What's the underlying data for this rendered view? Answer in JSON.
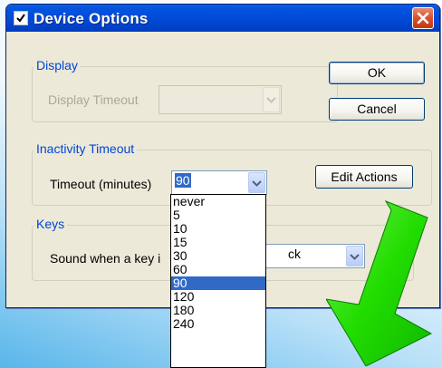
{
  "window": {
    "title": "Device Options",
    "title_icon": "checkbox-icon",
    "close_icon": "close-icon"
  },
  "display_group": {
    "legend": "Display",
    "timeout_label": "Display Timeout",
    "timeout_value": ""
  },
  "buttons": {
    "ok": "OK",
    "cancel": "Cancel",
    "edit_actions": "Edit Actions"
  },
  "inactivity_group": {
    "legend": "Inactivity Timeout",
    "timeout_label": "Timeout (minutes)",
    "timeout_value": "90",
    "options": [
      "never",
      "5",
      "10",
      "15",
      "30",
      "60",
      "90",
      "120",
      "180",
      "240"
    ],
    "selected_option": "90"
  },
  "keys_group": {
    "legend": "Keys",
    "sound_label": "Sound when a key i",
    "sound_value_visible": "ck"
  },
  "overlay": {
    "arrow_icon": "green-down-arrow-icon",
    "arrow_color": "#22dd00"
  },
  "colors": {
    "title_bar": "#0048d4",
    "selection": "#316ac5",
    "legend_text": "#0046d5"
  }
}
